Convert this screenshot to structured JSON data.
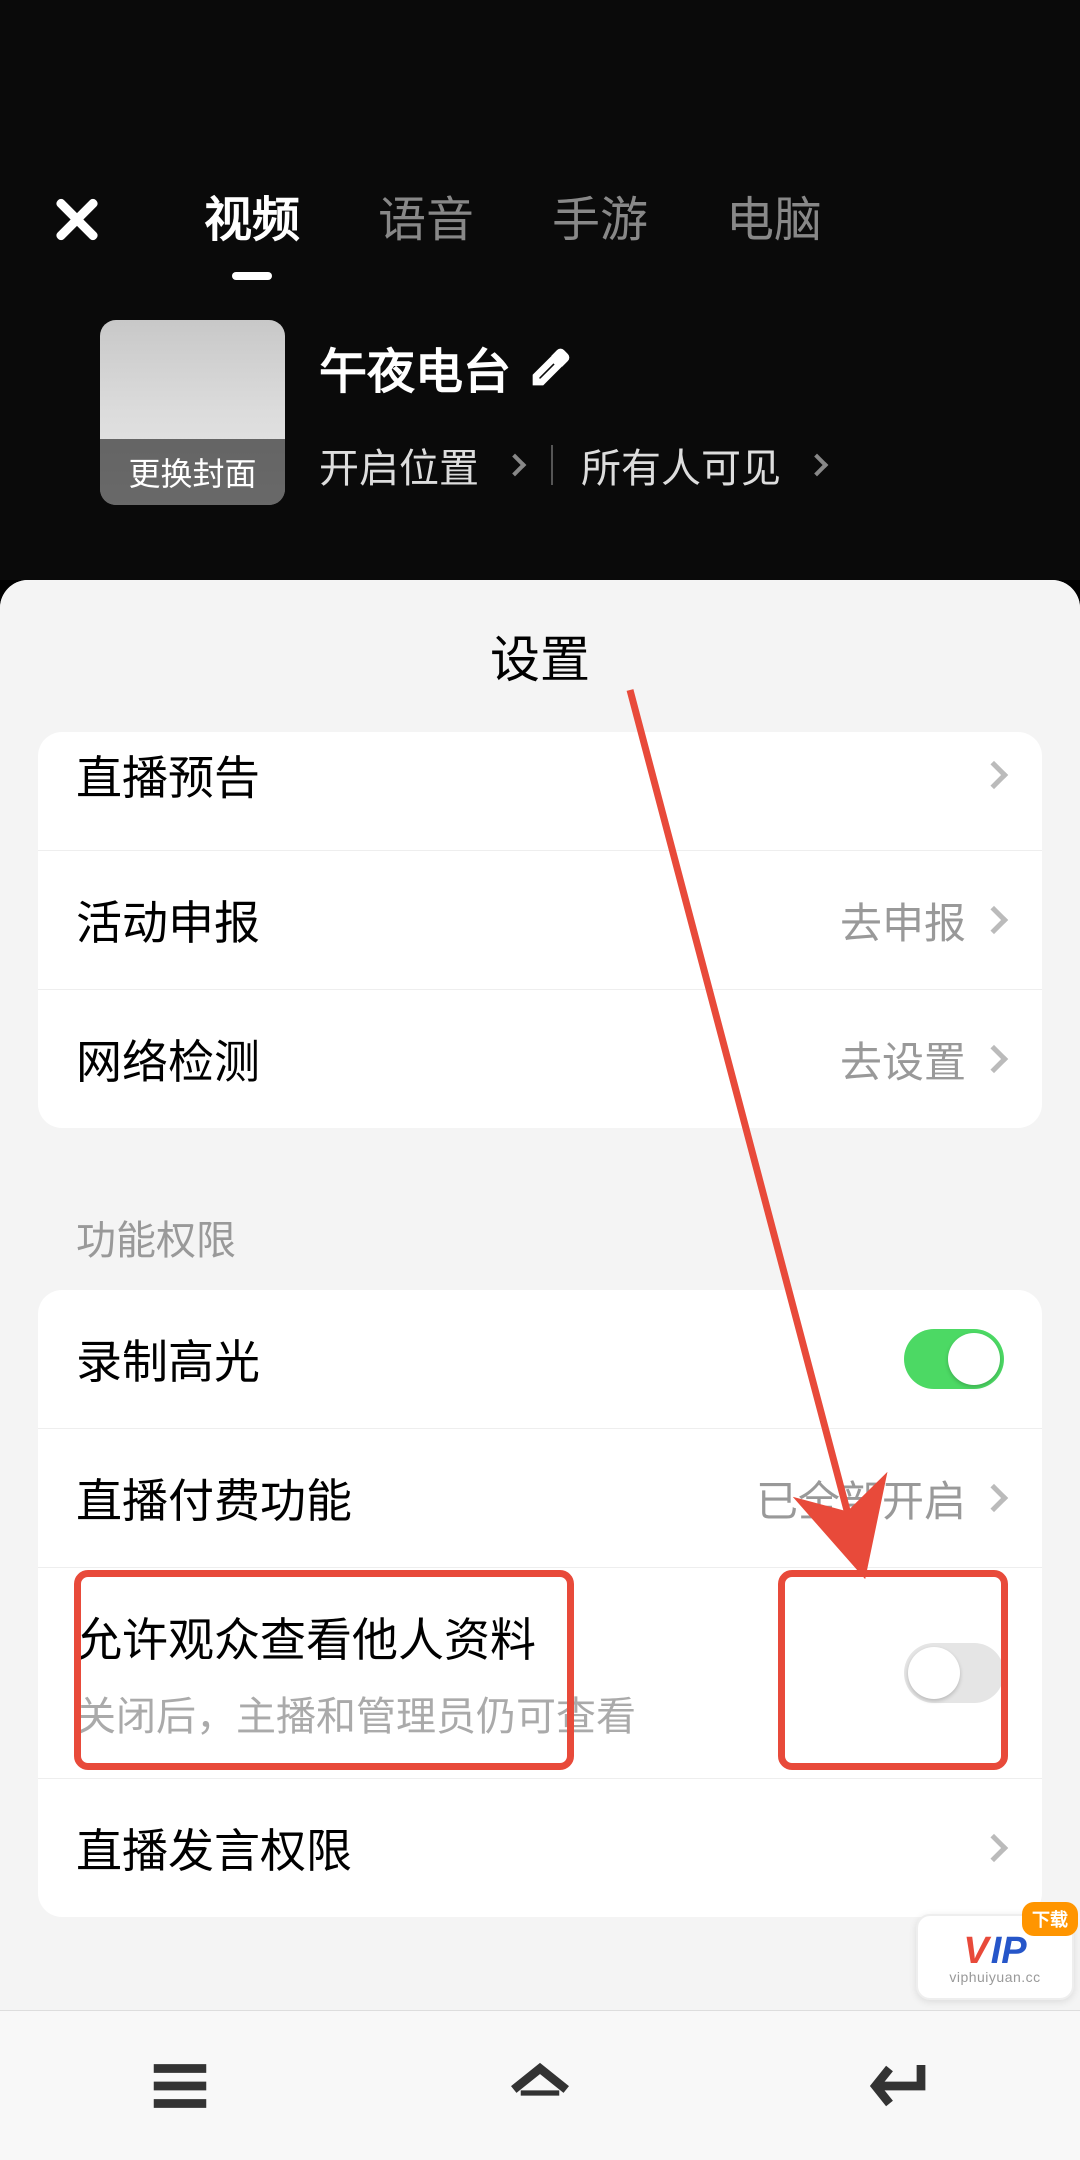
{
  "tabs": {
    "video": "视频",
    "voice": "语音",
    "mobile_game": "手游",
    "pc": "电脑"
  },
  "cover": {
    "change_label": "更换封面"
  },
  "stream": {
    "title": "午夜电台",
    "location_label": "开启位置",
    "visibility_label": "所有人可见"
  },
  "sheet_title": "设置",
  "rows": {
    "preview": {
      "label": "直播预告"
    },
    "activity": {
      "label": "活动申报",
      "value": "去申报"
    },
    "network": {
      "label": "网络检测",
      "value": "去设置"
    },
    "highlight": {
      "label": "录制高光"
    },
    "paid": {
      "label": "直播付费功能",
      "value": "已全部开启"
    },
    "profile_view": {
      "label": "允许观众查看他人资料",
      "sub": "关闭后，主播和管理员仍可查看"
    },
    "speak": {
      "label": "直播发言权限"
    }
  },
  "section_label": "功能权限",
  "vip": {
    "v": "V",
    "ip": "IP",
    "dl": "下载",
    "sub": "viphuiyuan.cc"
  }
}
